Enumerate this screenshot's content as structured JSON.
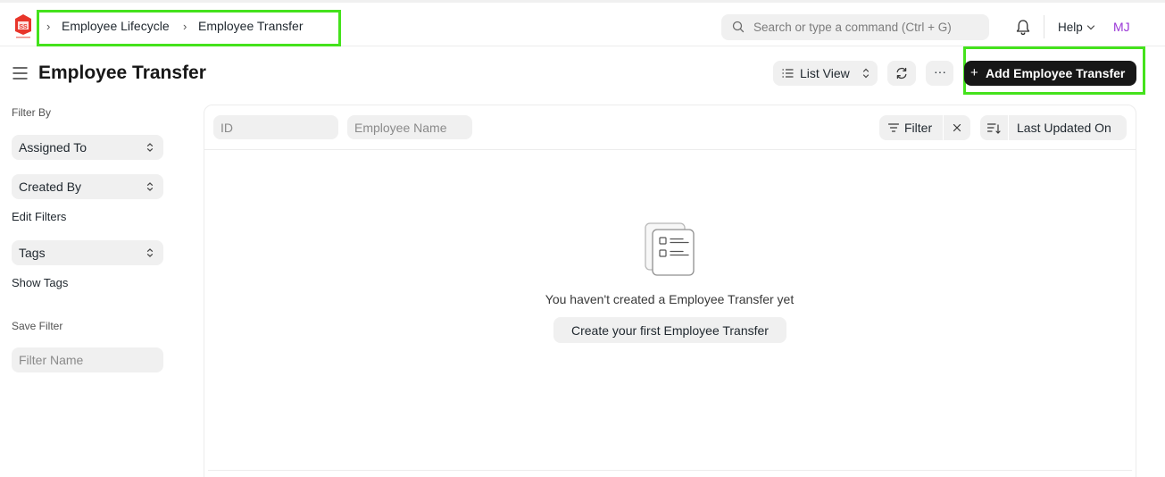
{
  "navbar": {
    "logo_text": "SS",
    "breadcrumbs": [
      "Employee Lifecycle",
      "Employee Transfer"
    ],
    "search_placeholder": "Search or type a command (Ctrl + G)",
    "help_label": "Help",
    "avatar_initials": "MJ"
  },
  "header": {
    "title": "Employee Transfer",
    "list_view_label": "List View",
    "more_label": "···",
    "add_label": "Add Employee Transfer"
  },
  "sidebar": {
    "filter_by_label": "Filter By",
    "assigned_to_label": "Assigned To",
    "created_by_label": "Created By",
    "edit_filters_label": "Edit Filters",
    "tags_label": "Tags",
    "show_tags_label": "Show Tags",
    "save_filter_label": "Save Filter",
    "filter_name_placeholder": "Filter Name"
  },
  "list": {
    "id_placeholder": "ID",
    "employee_name_placeholder": "Employee Name",
    "filter_label": "Filter",
    "sort_label": "Last Updated On",
    "empty_message": "You haven't created a Employee Transfer yet",
    "create_first_label": "Create your first Employee Transfer"
  },
  "colors": {
    "highlight": "#44e21c",
    "primary_button": "#171717",
    "avatar": "#9a37d6",
    "logo": "#e8352a"
  }
}
